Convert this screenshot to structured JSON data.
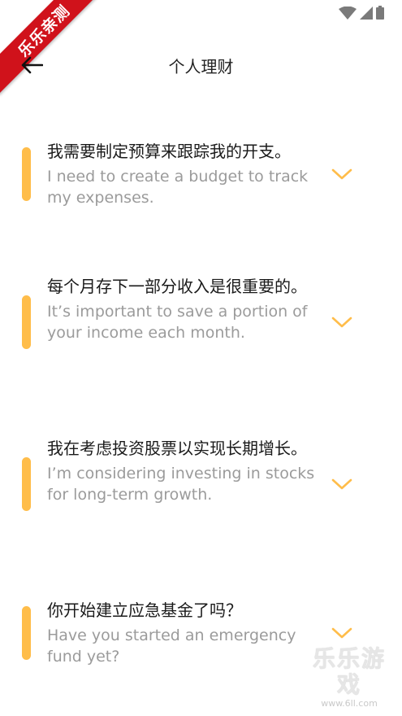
{
  "ribbon": {
    "label": "乐乐亲测"
  },
  "header": {
    "title": "个人理财"
  },
  "phrases": [
    {
      "zh": "我需要制定预算来跟踪我的开支。",
      "en": "I need to create a budget to track my expenses."
    },
    {
      "zh": "每个月存下一部分收入是很重要的。",
      "en": "It’s important to save a portion of your income each month."
    },
    {
      "zh": "我在考虑投资股票以实现长期增长。",
      "en": "I’m considering investing in stocks for long-term growth."
    },
    {
      "zh": "你开始建立应急基金了吗？",
      "en": "Have you started an emergency fund yet?"
    }
  ],
  "watermark": {
    "title": "乐乐游戏",
    "url": "www.6ll.com"
  },
  "colors": {
    "accent": "#ffbd4a",
    "ribbon": "#d0121b",
    "primary_text": "#1a1a1a",
    "secondary_text": "#9b9b9b"
  },
  "icons": {
    "back": "arrow-left-icon",
    "expand": "chevron-down-icon",
    "wifi": "wifi-icon",
    "signal": "signal-icon",
    "battery": "battery-icon"
  }
}
